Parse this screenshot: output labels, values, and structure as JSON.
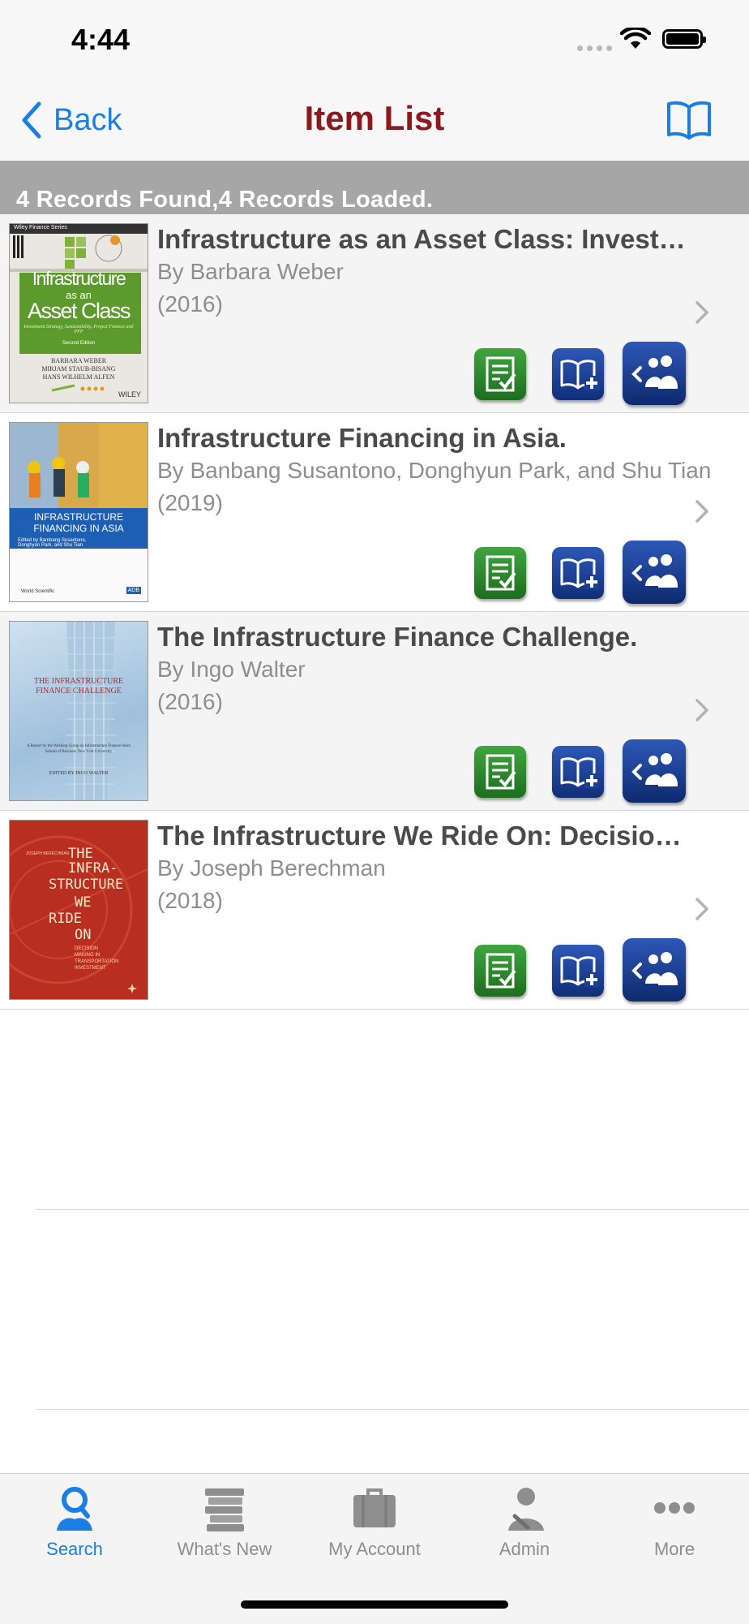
{
  "status_bar": {
    "time": "4:44"
  },
  "nav": {
    "back_label": "Back",
    "title": "Item List"
  },
  "banner": {
    "records_text": "4 Records Found,4 Records Loaded."
  },
  "items": [
    {
      "title": "Infrastructure as an Asset Class: Invest…",
      "author": "By Barbara Weber",
      "year": "(2016)",
      "cover": {
        "series": "Wiley Finance Series",
        "line1": "Infrastructure",
        "line2": "as an",
        "line3": "Asset Class",
        "subtitle": "Investment Strategy, Sustainability, Project Finance and PPP",
        "edition": "Second Edition",
        "authors": [
          "BARBARA WEBER",
          "MIRJAM STAUB-BISANG",
          "HANS WILHELM ALFEN"
        ],
        "publisher": "WILEY"
      }
    },
    {
      "title": "Infrastructure Financing in Asia.",
      "author": "By Banbang Susantono, Donghyun Park, and Shu Tian",
      "year": "(2019)",
      "cover": {
        "line1": "INFRASTRUCTURE",
        "line2": "FINANCING IN ASIA",
        "edited": "Edited by Bambang Susantono, Donghyun Park, and Shu Tian",
        "publisher": "World Scientific",
        "badge": "ADB"
      }
    },
    {
      "title": "The Infrastructure Finance Challenge.",
      "author": "By Ingo Walter",
      "year": "(2016)",
      "cover": {
        "line1": "THE INFRASTRUCTURE",
        "line2": "FINANCE CHALLENGE",
        "report": "A Report by the Working Group on Infrastructure Finance Stern School of Business New York University",
        "editor": "EDITED BY INGO WALTER"
      }
    },
    {
      "title": "The Infrastructure We Ride On: Decisio…",
      "author": "By Joseph Berechman",
      "year": "(2018)",
      "cover": {
        "author": "JOSEPH BERECHMAN",
        "lines": [
          "THE",
          "INFRA-",
          "STRUCTURE",
          "WE",
          "RIDE",
          "ON"
        ],
        "subtitle_lines": [
          "DECISION",
          "MAKING IN",
          "TRANSPORTATION",
          "INVESTMENT"
        ]
      }
    }
  ],
  "tabs": [
    {
      "label": "Search",
      "icon": "search-person-icon",
      "active": true
    },
    {
      "label": "What's New",
      "icon": "books-stack-icon",
      "active": false
    },
    {
      "label": "My Account",
      "icon": "briefcase-icon",
      "active": false
    },
    {
      "label": "Admin",
      "icon": "admin-person-icon",
      "active": false
    },
    {
      "label": "More",
      "icon": "more-dots-icon",
      "active": false
    }
  ],
  "colors": {
    "accent": "#1a7ee6",
    "title": "#8b1a1f",
    "banner": "#a6a6a6",
    "review_button": "#2f8f2f",
    "shelf_button": "#1d3f93"
  }
}
